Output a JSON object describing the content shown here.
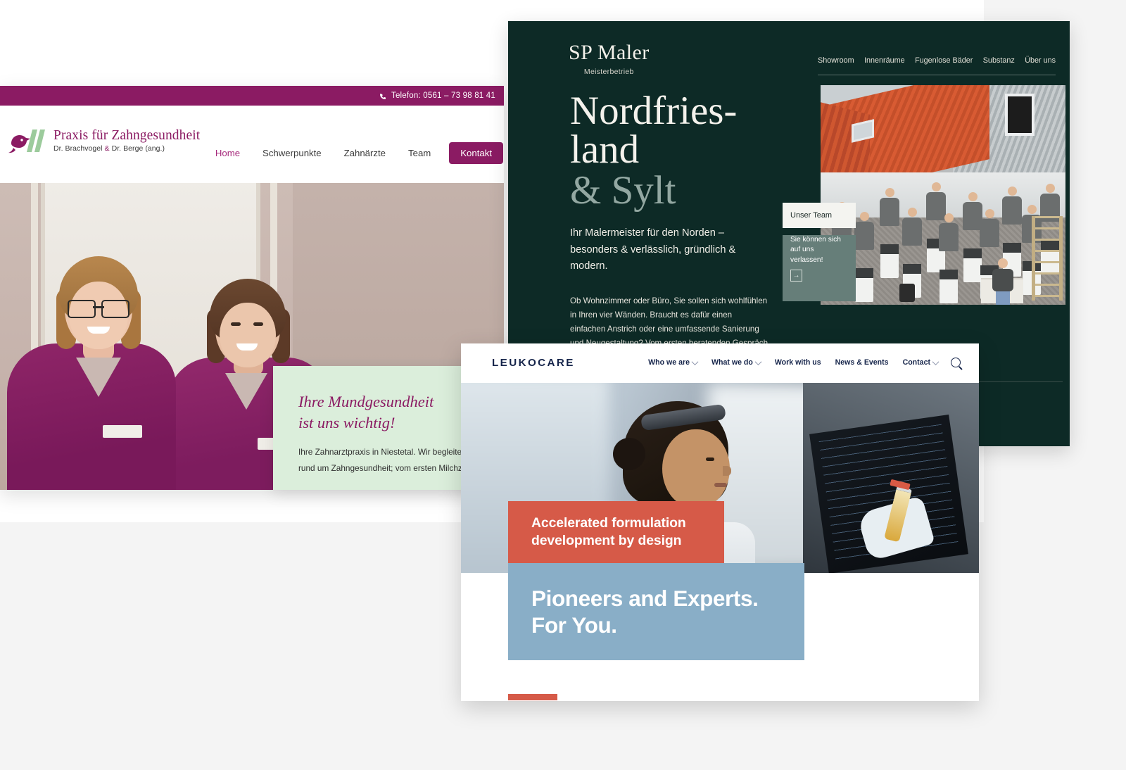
{
  "dental": {
    "topbar": {
      "phone_icon": "phone-icon",
      "phone_text": "Telefon: 0561 – 73 98 81 41"
    },
    "logo": {
      "icon": "bird-logo-icon",
      "title": "Praxis für Zahngesundheit",
      "sub_pre": "Dr. Brachvogel ",
      "sub_amp": "&",
      "sub_post": " Dr. Berge (ang.)"
    },
    "nav": [
      {
        "label": "Home",
        "active": true
      },
      {
        "label": "Schwerpunkte",
        "active": false
      },
      {
        "label": "Zahnärzte",
        "active": false
      },
      {
        "label": "Team",
        "active": false
      }
    ],
    "cta": "Kontakt",
    "green_box": {
      "heading_line1": "Ihre Mundgesundheit",
      "heading_line2": "ist uns wichtig!",
      "body_line1": "Ihre Zahnarztpraxis in Niestetal. Wir begleiten Sie bei allen Fragen",
      "body_line2": "rund um Zahngesundheit; vom ersten Milchzahn bis ins hohe Alter."
    },
    "colors": {
      "brand": "#8b1b63",
      "accent_green": "#dbeedb"
    }
  },
  "maler": {
    "logo": {
      "main": "SP Maler",
      "sub": "Meisterbetrieb"
    },
    "nav": [
      {
        "label": "Showroom"
      },
      {
        "label": "Innenräume"
      },
      {
        "label": "Fugenlose Bäder"
      },
      {
        "label": "Substanz"
      },
      {
        "label": "Über uns"
      }
    ],
    "title_line1": "Nordfries-",
    "title_line2": "land",
    "title_accent": "& Sylt",
    "lead": "Ihr Malermeister für den Norden – besonders & verlässlich, gründlich & modern.",
    "body": "Ob Wohnzimmer oder Büro, Sie sollen sich wohlfühlen in Ihren vier Wänden. Braucht es dafür einen einfachen Anstrich oder eine umfassende Sanierung und Neugestaltung? Vom ersten beratenden Gespräch bis zur fertigen Gestaltung sind wir an Ihrer Seite.",
    "team_card": {
      "title": "Unser Team",
      "text": "Sie können sich auf uns verlassen!",
      "arrow_icon": "arrow-right-icon"
    },
    "photo_alt": "team-photo",
    "colors": {
      "bg": "#0d2a26",
      "accent": "#93a8a2",
      "card": "#667e79"
    }
  },
  "leukocare": {
    "logo": "LEUKOCARE",
    "nav": [
      {
        "label": "Who we are",
        "caret": true
      },
      {
        "label": "What we do",
        "caret": true
      },
      {
        "label": "Work with us",
        "caret": false
      },
      {
        "label": "News & Events",
        "caret": false
      },
      {
        "label": "Contact",
        "caret": true
      }
    ],
    "search_icon": "search-icon",
    "banner_red_line1": "Accelerated formulation",
    "banner_red_line2": "development by design",
    "banner_blue_line1": "Pioneers and Experts.",
    "banner_blue_line2": "For You.",
    "hero_alt": "scientist-at-monitor-photo",
    "colors": {
      "navy": "#15244a",
      "red": "#d65a48",
      "blue": "#89aec7"
    }
  }
}
